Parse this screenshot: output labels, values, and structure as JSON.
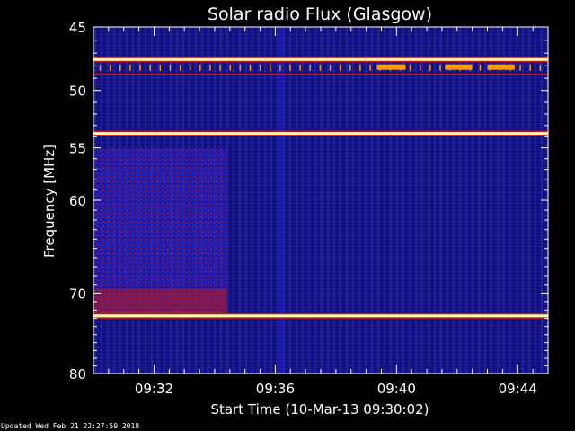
{
  "title": "Solar radio Flux (Glasgow)",
  "updated_text": "Updated Wed Feb 21 22:27:50 2018",
  "chart_data": {
    "type": "heatmap",
    "title": "Solar radio Flux (Glasgow)",
    "xlabel": "Start Time (10-Mar-13 09:30:02)",
    "ylabel": "Frequency [MHz]",
    "x_start": "09:30:02",
    "x_range_minutes": [
      0,
      15
    ],
    "x_ticks": [
      {
        "label": "09:32",
        "minute": 2
      },
      {
        "label": "09:36",
        "minute": 6
      },
      {
        "label": "09:40",
        "minute": 10
      },
      {
        "label": "09:44",
        "minute": 14
      }
    ],
    "ylim": [
      45,
      80
    ],
    "y_axis_inverted": true,
    "y_scale": "log",
    "y_ticks": [
      45,
      50,
      55,
      60,
      70,
      80
    ],
    "colormap": [
      "#000000",
      "#0a0a6e",
      "#2020d0",
      "#c01818",
      "#ff9a00",
      "#ffffb0"
    ],
    "features": [
      {
        "kind": "interference-band",
        "freq_mhz": 47.5,
        "start_min": 0,
        "end_min": 15,
        "intensity": "high"
      },
      {
        "kind": "interference-band",
        "freq_mhz": 48.7,
        "start_min": 0,
        "end_min": 15,
        "intensity": "medium"
      },
      {
        "kind": "interference-band",
        "freq_mhz": 53.7,
        "start_min": 0,
        "end_min": 15,
        "intensity": "high"
      },
      {
        "kind": "interference-band",
        "freq_mhz": 72.7,
        "start_min": 0,
        "end_min": 15,
        "intensity": "high"
      },
      {
        "kind": "enhanced-emission",
        "freq_range_mhz": [
          55,
          73
        ],
        "start_min": 0,
        "end_min": 4.4,
        "intensity": "medium"
      },
      {
        "kind": "vertical-burst",
        "freq_range_mhz": [
          45,
          80
        ],
        "minute": 6.2,
        "intensity": "low"
      }
    ]
  }
}
